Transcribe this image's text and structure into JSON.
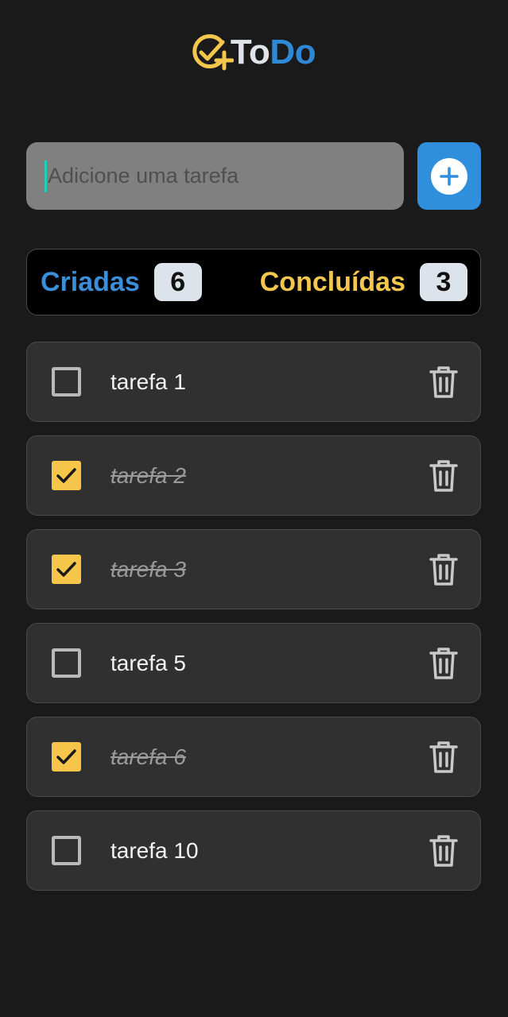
{
  "logo": {
    "part1": "To",
    "part2": "Do",
    "icon": "check-circle-plus-icon",
    "colors": {
      "icon": "#f3c74e",
      "to": "#dfe4ea",
      "do": "#2f88d6"
    }
  },
  "new_task": {
    "placeholder": "Adicione uma tarefa",
    "value": "",
    "add_icon": "plus-circle-icon"
  },
  "stats": {
    "created_label": "Criadas",
    "created_count": "6",
    "done_label": "Concluídas",
    "done_count": "3"
  },
  "tasks": [
    {
      "text": "tarefa 1",
      "done": false
    },
    {
      "text": "tarefa 2",
      "done": true
    },
    {
      "text": "tarefa 3",
      "done": true
    },
    {
      "text": "tarefa 5",
      "done": false
    },
    {
      "text": "tarefa 6",
      "done": true
    },
    {
      "text": "tarefa 10",
      "done": false
    }
  ],
  "colors": {
    "background": "#1a1a1a",
    "accent_blue": "#2f8fdc",
    "accent_yellow": "#f6c64a",
    "card": "#303030"
  }
}
